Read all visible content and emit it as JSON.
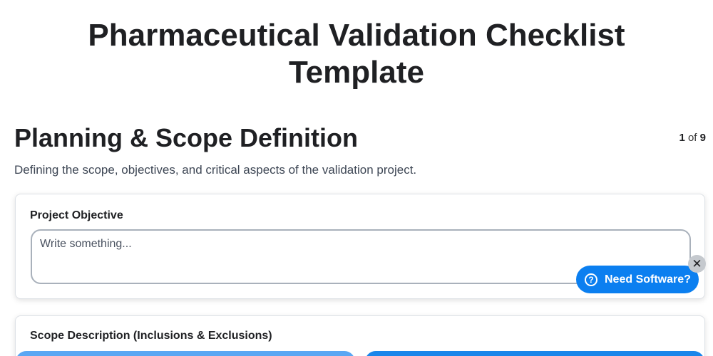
{
  "header": {
    "title": "Pharmaceutical Validation Checklist Template"
  },
  "section": {
    "title": "Planning & Scope Definition",
    "description": "Defining the scope, objectives, and critical aspects of the validation project.",
    "pager": {
      "current": "1",
      "separator": "of",
      "total": "9"
    }
  },
  "fields": [
    {
      "label": "Project Objective",
      "placeholder": "Write something..."
    },
    {
      "label": "Scope Description (Inclusions & Exclusions)"
    }
  ],
  "widget": {
    "label": "Need Software?",
    "help_icon_glyph": "?",
    "close_icon_glyph": "✕"
  },
  "colors": {
    "accent": "#0b7ff0",
    "text": "#1f2023",
    "muted": "#3d4654"
  }
}
